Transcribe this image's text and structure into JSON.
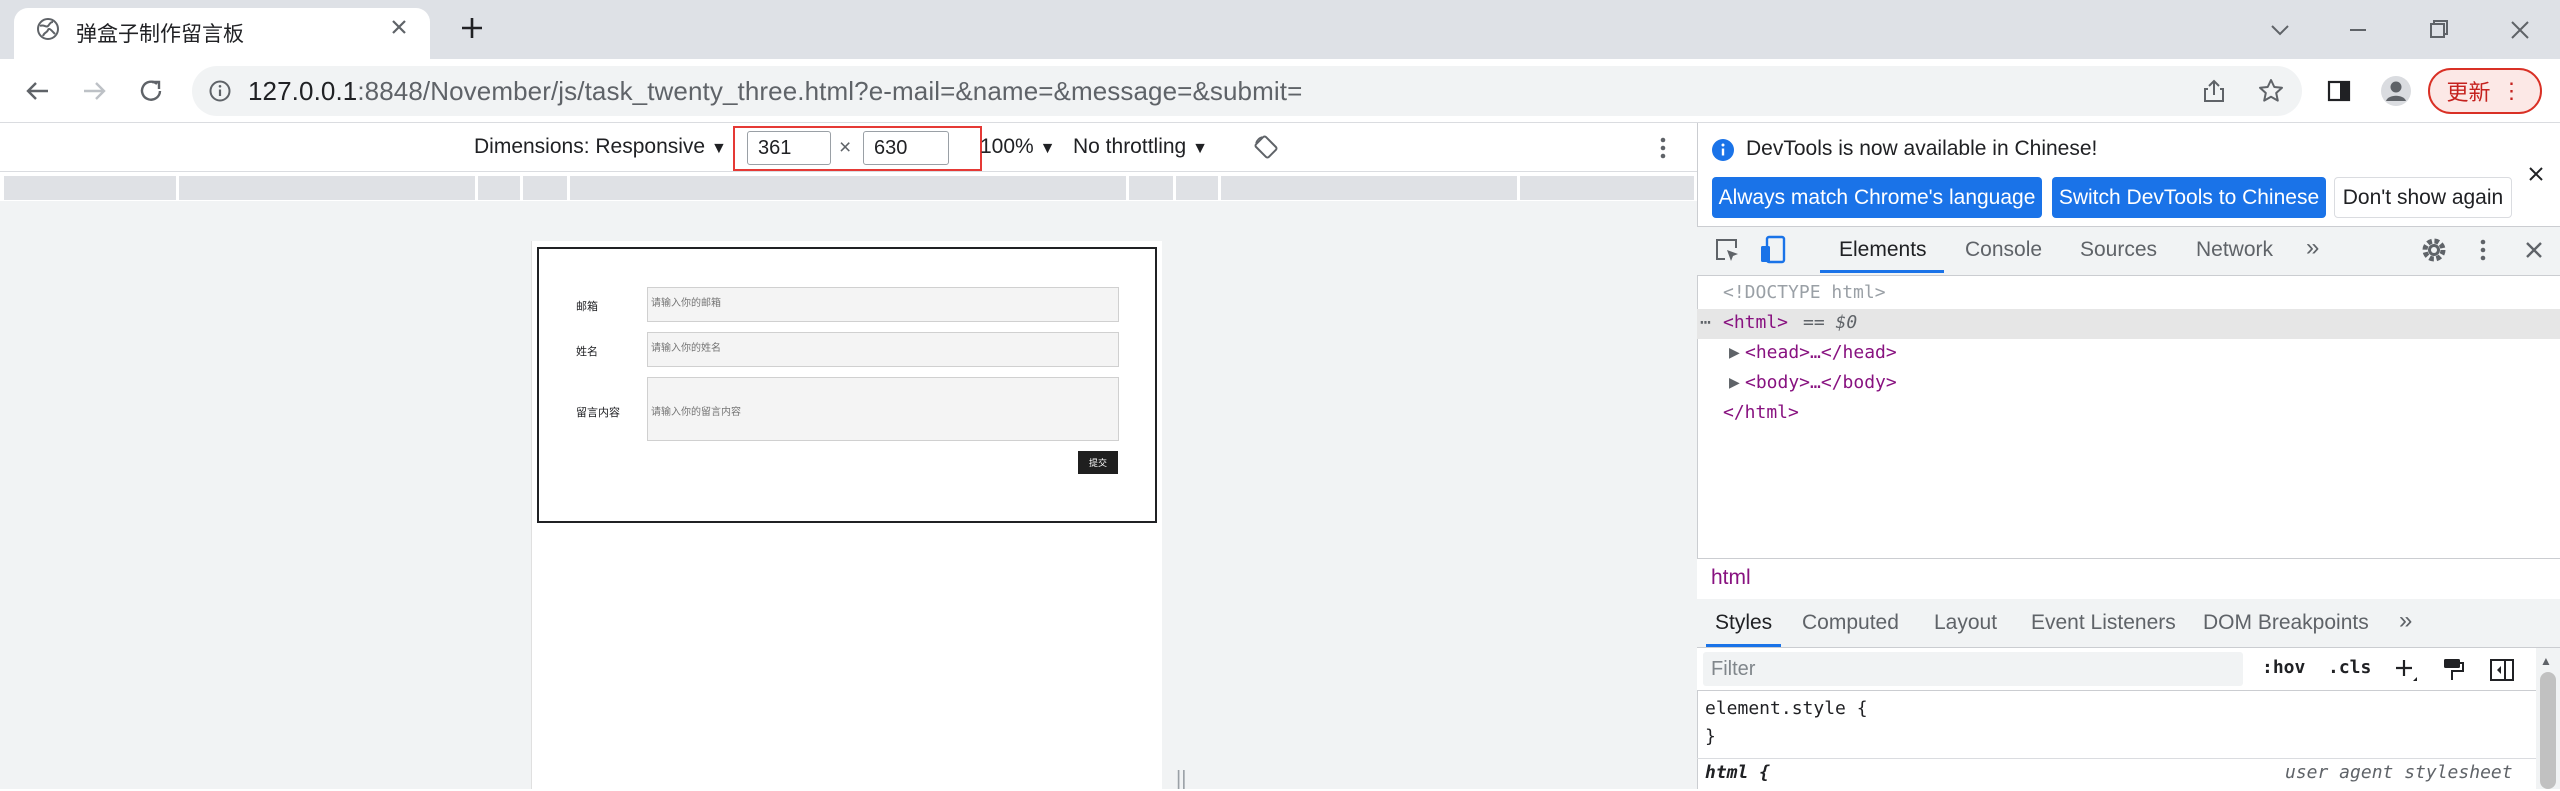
{
  "browser": {
    "tab_title": "弹盒子制作留言板",
    "url_host": "127.0.0.1",
    "url_rest": ":8848/November/js/task_twenty_three.html?e-mail=&name=&message=&submit=",
    "update_label": "更新"
  },
  "device_toolbar": {
    "dimensions_label": "Dimensions: Responsive",
    "width": "361",
    "times": "×",
    "height": "630",
    "zoom": "100%",
    "throttling": "No throttling"
  },
  "page_form": {
    "email_label": "邮箱",
    "email_placeholder": "请输入你的邮箱",
    "name_label": "姓名",
    "name_placeholder": "请输入你的姓名",
    "message_label": "留言内容",
    "message_placeholder": "请输入你的留言内容",
    "submit_label": "提交"
  },
  "devtools": {
    "info_text": "DevTools is now available in Chinese!",
    "btn_match": "Always match Chrome's language",
    "btn_switch": "Switch DevTools to Chinese",
    "btn_dont_show": "Don't show again",
    "tabs": [
      "Elements",
      "Console",
      "Sources",
      "Network"
    ],
    "dom_doctype": "<!DOCTYPE html>",
    "dom_html_open": "<html>",
    "dom_eq": "== $0",
    "dom_head": "<head>…</head>",
    "dom_body": "<body>…</body>",
    "dom_html_close": "</html>",
    "breadcrumb": "html",
    "styles_tabs": [
      "Styles",
      "Computed",
      "Layout",
      "Event Listeners",
      "DOM Breakpoints"
    ],
    "filter_placeholder": "Filter",
    "hov": ":hov",
    "cls": ".cls",
    "rule1_selector": "element.style {",
    "rule1_close": "}",
    "rule2_selector": "html {",
    "rule2_source": "user agent stylesheet"
  },
  "colors": {
    "accent": "#1a73e8",
    "highlight_outline": "#e53935",
    "update_red": "#d93025"
  }
}
